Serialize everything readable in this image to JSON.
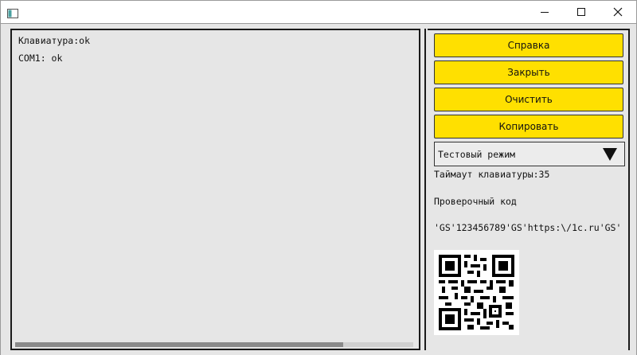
{
  "titlebar": {
    "title": "",
    "icons": [
      "app-icon",
      "minimize-icon",
      "maximize-icon",
      "close-icon"
    ]
  },
  "log": {
    "lines": [
      "Клавиатура:ok",
      "COM1: ok"
    ],
    "scroll_position": 0
  },
  "buttons": {
    "help": "Справка",
    "close": "Закрыть",
    "clear": "Очистить",
    "copy": "Копировать"
  },
  "mode_select": {
    "value": "Тестовый режим",
    "arrow_icon": "triangle-down-icon"
  },
  "info": {
    "timeout": "Таймаут клавиатуры:35",
    "check_code_label": "Проверочный код",
    "check_code_value": "'GS'123456789'GS'https:\\/1c.ru'GS'"
  },
  "qr": {
    "icon": "qr-code"
  },
  "colors": {
    "accent": "#ffe000",
    "background": "#e6e6e6",
    "border": "#1a1a1a"
  }
}
